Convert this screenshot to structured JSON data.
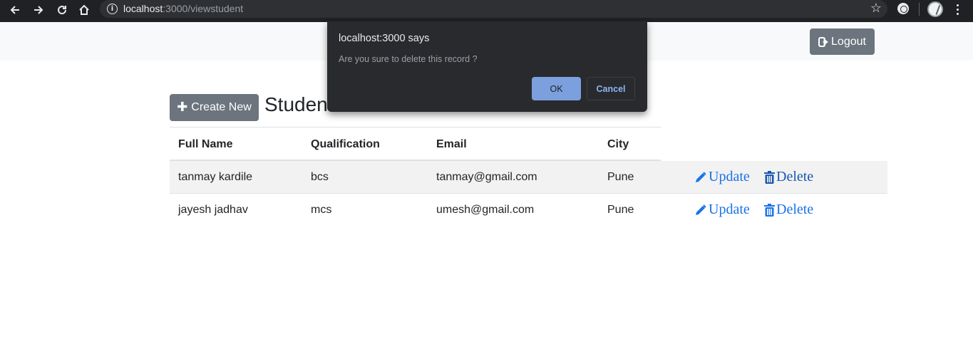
{
  "browser": {
    "url_host": "localhost",
    "url_path": ":3000/viewstudent",
    "icons": [
      "back-arrow-icon",
      "forward-arrow-icon",
      "reload-icon",
      "home-icon",
      "info-icon",
      "star-icon",
      "extension-icon",
      "profile-icon",
      "menu-icon"
    ]
  },
  "navbar": {
    "logout_label": "Logout"
  },
  "content": {
    "create_label": "Create New",
    "title": "Student List"
  },
  "table": {
    "headers": [
      "Full Name",
      "Qualification",
      "Email",
      "City"
    ],
    "rows": [
      {
        "full_name": "tanmay kardile",
        "qualification": "bcs",
        "email": "tanmay@gmail.com",
        "city": "Pune",
        "update_label": "Update",
        "delete_label": "Delete"
      },
      {
        "full_name": "jayesh jadhav",
        "qualification": "mcs",
        "email": "umesh@gmail.com",
        "city": "Pune",
        "update_label": "Update",
        "delete_label": "Delete"
      }
    ]
  },
  "dialog": {
    "title": "localhost:3000 says",
    "message": "Are you sure to delete this record ?",
    "ok_label": "OK",
    "cancel_label": "Cancel"
  },
  "colors": {
    "chrome_bg": "#202124",
    "navbar_bg": "#f8f9fa",
    "secondary_button": "#6c757d",
    "link_blue": "#1a73e8",
    "dialog_bg": "#292a2d",
    "ok_button": "#7ca0dd"
  }
}
